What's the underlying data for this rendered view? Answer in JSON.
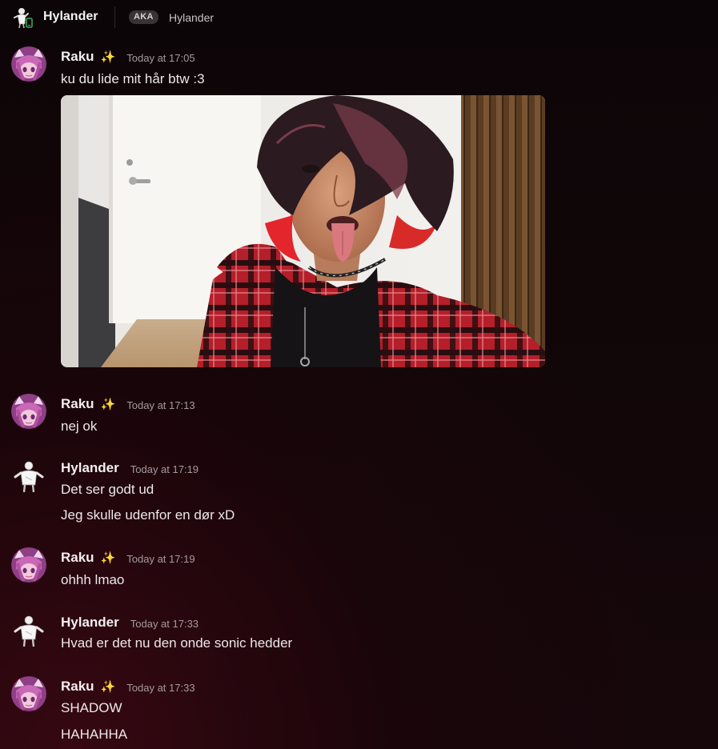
{
  "header": {
    "title": "Hylander",
    "aka_badge": "AKA",
    "aka_name": "Hylander"
  },
  "messages": [
    {
      "author": "Raku",
      "sparkle": "✨",
      "timestamp": "Today at 17:05",
      "lines": [
        "ku du lide mit hår btw :3"
      ],
      "has_image": true
    },
    {
      "author": "Raku",
      "sparkle": "✨",
      "timestamp": "Today at 17:13",
      "lines": [
        "nej ok"
      ]
    },
    {
      "author": "Hylander",
      "timestamp": "Today at 17:19",
      "lines": [
        "Det ser godt ud",
        "Jeg skulle udenfor en dør xD"
      ]
    },
    {
      "author": "Raku",
      "sparkle": "✨",
      "timestamp": "Today at 17:19",
      "lines": [
        "ohhh lmao"
      ]
    },
    {
      "author": "Hylander",
      "timestamp": "Today at 17:33",
      "lines": [
        "Hvad er det nu den onde sonic hedder"
      ]
    },
    {
      "author": "Raku",
      "sparkle": "✨",
      "timestamp": "Today at 17:33",
      "lines": [
        "SHADOW",
        "HAHAHHA"
      ]
    }
  ],
  "colors": {
    "raku_avatar": "#b0529c",
    "hylander_avatar": "#e8e8e8",
    "badge_bg": "#3a3336",
    "hair_red": "#e2262c",
    "flannel_red": "#b41f2a"
  }
}
